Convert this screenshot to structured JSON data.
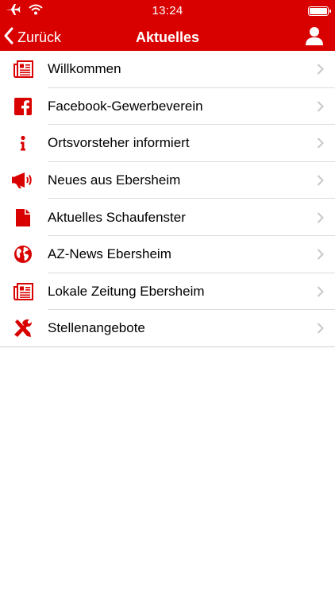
{
  "status_bar": {
    "time": "13:24"
  },
  "nav": {
    "back_label": "Zurück",
    "title": "Aktuelles"
  },
  "colors": {
    "accent": "#d90000",
    "separator": "#dcdcdc",
    "chevron": "#c7c7cc"
  },
  "menu": [
    {
      "label": "Willkommen",
      "icon": "newspaper-icon"
    },
    {
      "label": "Facebook-Gewerbeverein",
      "icon": "facebook-icon"
    },
    {
      "label": "Ortsvorsteher informiert",
      "icon": "info-icon"
    },
    {
      "label": "Neues aus Ebersheim",
      "icon": "megaphone-icon"
    },
    {
      "label": "Aktuelles Schaufenster",
      "icon": "document-icon"
    },
    {
      "label": "AZ-News Ebersheim",
      "icon": "globe-icon"
    },
    {
      "label": "Lokale Zeitung Ebersheim",
      "icon": "newspaper-icon"
    },
    {
      "label": "Stellenangebote",
      "icon": "tools-icon"
    }
  ]
}
